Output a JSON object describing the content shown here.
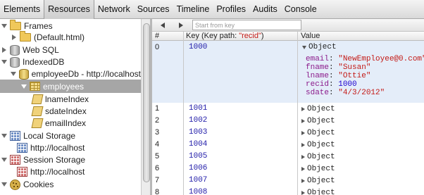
{
  "toolbar": {
    "tabs": [
      {
        "label": "Elements",
        "active": false
      },
      {
        "label": "Resources",
        "active": true
      },
      {
        "label": "Network",
        "active": false
      },
      {
        "label": "Sources",
        "active": false
      },
      {
        "label": "Timeline",
        "active": false
      },
      {
        "label": "Profiles",
        "active": false
      },
      {
        "label": "Audits",
        "active": false
      },
      {
        "label": "Console",
        "active": false
      }
    ]
  },
  "sidebar": {
    "frames": "Frames",
    "default_html": "(Default.html)",
    "web_sql": "Web SQL",
    "indexeddb": "IndexedDB",
    "db_name": "employeeDb - http://localhost",
    "store": "employees",
    "indexes": [
      "lnameIndex",
      "sdateIndex",
      "emailIndex"
    ],
    "local_storage": "Local Storage",
    "local_storage_origin": "http://localhost",
    "session_storage": "Session Storage",
    "session_storage_origin": "http://localhost",
    "cookies": "Cookies"
  },
  "navigator": {
    "key_placeholder": "Start from key"
  },
  "grid": {
    "col_index": "#",
    "col_key_prefix": "Key (Key path: ",
    "col_key_path": "\"recid\"",
    "col_key_suffix": ")",
    "col_value": "Value",
    "object_label": "Object",
    "expanded_row": {
      "index": "0",
      "key": "1000",
      "props": [
        {
          "name": "email",
          "value": "\"NewEmployee@0.com\"",
          "kind": "str"
        },
        {
          "name": "fname",
          "value": "\"Susan\"",
          "kind": "str"
        },
        {
          "name": "lname",
          "value": "\"Ottie\"",
          "kind": "str"
        },
        {
          "name": "recid",
          "value": "1000",
          "kind": "num"
        },
        {
          "name": "sdate",
          "value": "\"4/3/2012\"",
          "kind": "str"
        }
      ]
    },
    "rows": [
      {
        "index": "1",
        "key": "1001"
      },
      {
        "index": "2",
        "key": "1002"
      },
      {
        "index": "3",
        "key": "1003"
      },
      {
        "index": "4",
        "key": "1004"
      },
      {
        "index": "5",
        "key": "1005"
      },
      {
        "index": "6",
        "key": "1006"
      },
      {
        "index": "7",
        "key": "1007"
      },
      {
        "index": "8",
        "key": "1008"
      }
    ]
  }
}
